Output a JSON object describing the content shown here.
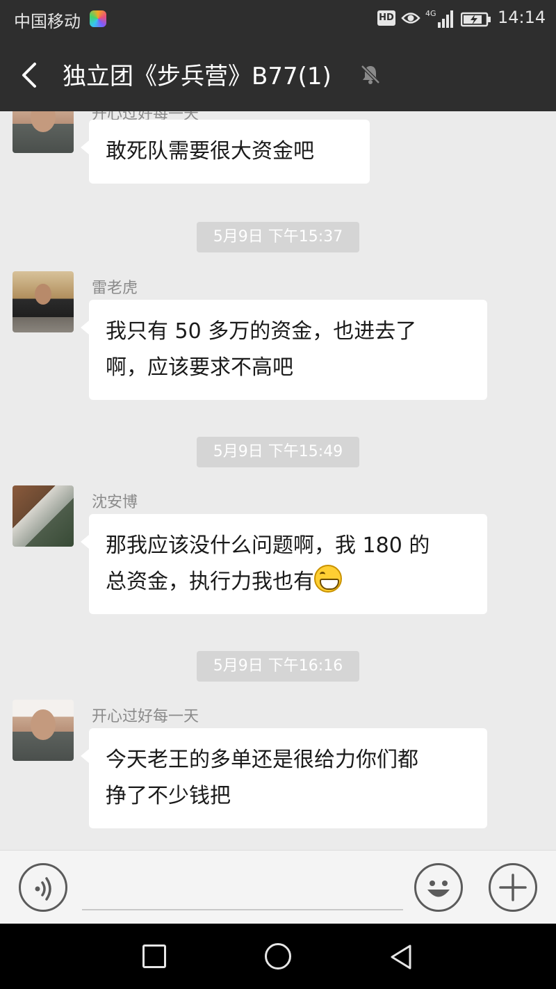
{
  "status_bar": {
    "carrier": "中国移动",
    "hd_badge": "HD",
    "network": "4G",
    "time": "14:14",
    "icons": [
      "colorful-app-icon",
      "hd-badge",
      "eye-icon",
      "signal-4g-icon",
      "battery-charging-icon"
    ]
  },
  "header": {
    "back_icon": "chevron-left-icon",
    "title": "独立团《步兵营》B77(1)",
    "mute_icon": "bell-muted-icon"
  },
  "messages": [
    {
      "type": "message",
      "sender": "开心过好每一天",
      "partially_visible_name": true,
      "lines": [
        "敢死队需要很大资金吧"
      ]
    },
    {
      "type": "timestamp",
      "text": "5月9日  下午15:37"
    },
    {
      "type": "message",
      "sender": "雷老虎",
      "lines": [
        "我只有 50 多万的资金，也进去了",
        "啊，应该要求不高吧"
      ]
    },
    {
      "type": "timestamp",
      "text": "5月9日  下午15:49"
    },
    {
      "type": "message",
      "sender": "沈安博",
      "lines": [
        "那我应该没什么问题啊，我 180 的",
        "总资金，执行力我也有"
      ],
      "trailing_emoji": "grinning-face-emoji"
    },
    {
      "type": "timestamp",
      "text": "5月9日  下午16:16"
    },
    {
      "type": "message",
      "sender": "开心过好每一天",
      "lines": [
        "今天老王的多单还是很给力你们都",
        "挣了不少钱把"
      ]
    }
  ],
  "input_bar": {
    "voice_icon": "voice-input-icon",
    "input_value": "",
    "emoji_icon": "emoji-face-icon",
    "more_icon": "plus-icon"
  },
  "nav_bar": {
    "icons": [
      "recents-square-icon",
      "home-circle-icon",
      "back-triangle-icon"
    ]
  },
  "colors": {
    "header_bg": "#2e2e2e",
    "chat_bg": "#ebebeb",
    "bubble_bg": "#ffffff",
    "timestamp_bg": "#d5d5d5",
    "name_color": "#8a8a8a"
  }
}
